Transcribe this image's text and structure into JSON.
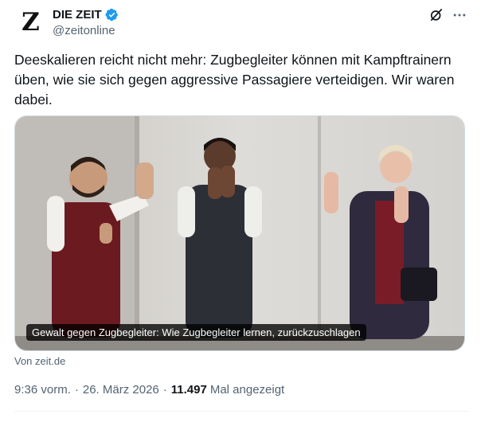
{
  "account": {
    "avatar_letter": "Z",
    "display_name": "DIE ZEIT",
    "handle": "@zeitonline",
    "verified": true
  },
  "header_icons": [
    "grok-icon",
    "more-icon"
  ],
  "tweet": {
    "text": "Deeskalieren reicht nicht mehr: Zugbegleiter können mit Kampftrainern üben, wie sie sich gegen aggressive Passagiere verteidigen. Wir waren dabei."
  },
  "card": {
    "caption": "Gewalt gegen Zugbegleiter: Wie Zugbegleiter lernen, zurückzuschlagen",
    "source": "Von zeit.de"
  },
  "meta": {
    "time": "9:36 vorm.",
    "separator": "·",
    "date": "26. März 2026",
    "views_count": "11.497",
    "views_label": "Mal angezeigt"
  },
  "colors": {
    "text": "#0f1419",
    "secondary": "#536471",
    "verified": "#1d9bf0"
  }
}
